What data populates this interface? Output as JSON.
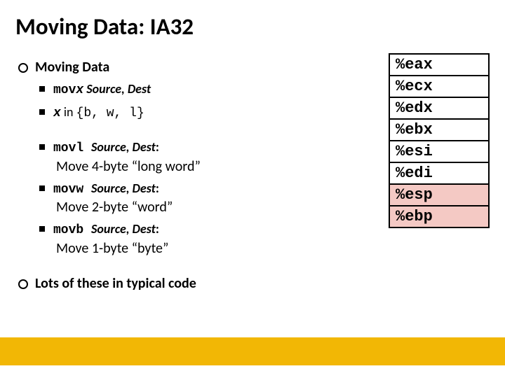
{
  "title": "Moving Data: IA32",
  "bullets": {
    "b1a": "Moving Data",
    "b2a_mono": "mov",
    "b2a_monoX": "x",
    "b2a_rest": "  Source, Dest",
    "b2b_monoX": "x",
    "b2b_rest1": " in ",
    "b2b_rest2": "{b, w, l}",
    "b2c_mono": "movl ",
    "b2c_rest": "Source, Dest",
    "b2c_col": ":",
    "b2c_desc": "Move 4-byte “long word”",
    "b2d_mono": "movw ",
    "b2d_rest": "Source, Dest",
    "b2d_col": ":",
    "b2d_desc": "Move 2-byte “word”",
    "b2e_mono": "movb ",
    "b2e_rest": "Source, Dest",
    "b2e_col": ":",
    "b2e_desc": "Move 1-byte “byte”",
    "b1b": "Lots of these in typical code"
  },
  "registers": {
    "r0": "%eax",
    "r1": "%ecx",
    "r2": "%edx",
    "r3": "%ebx",
    "r4": "%esi",
    "r5": "%edi",
    "r6": "%esp",
    "r7": "%ebp"
  }
}
